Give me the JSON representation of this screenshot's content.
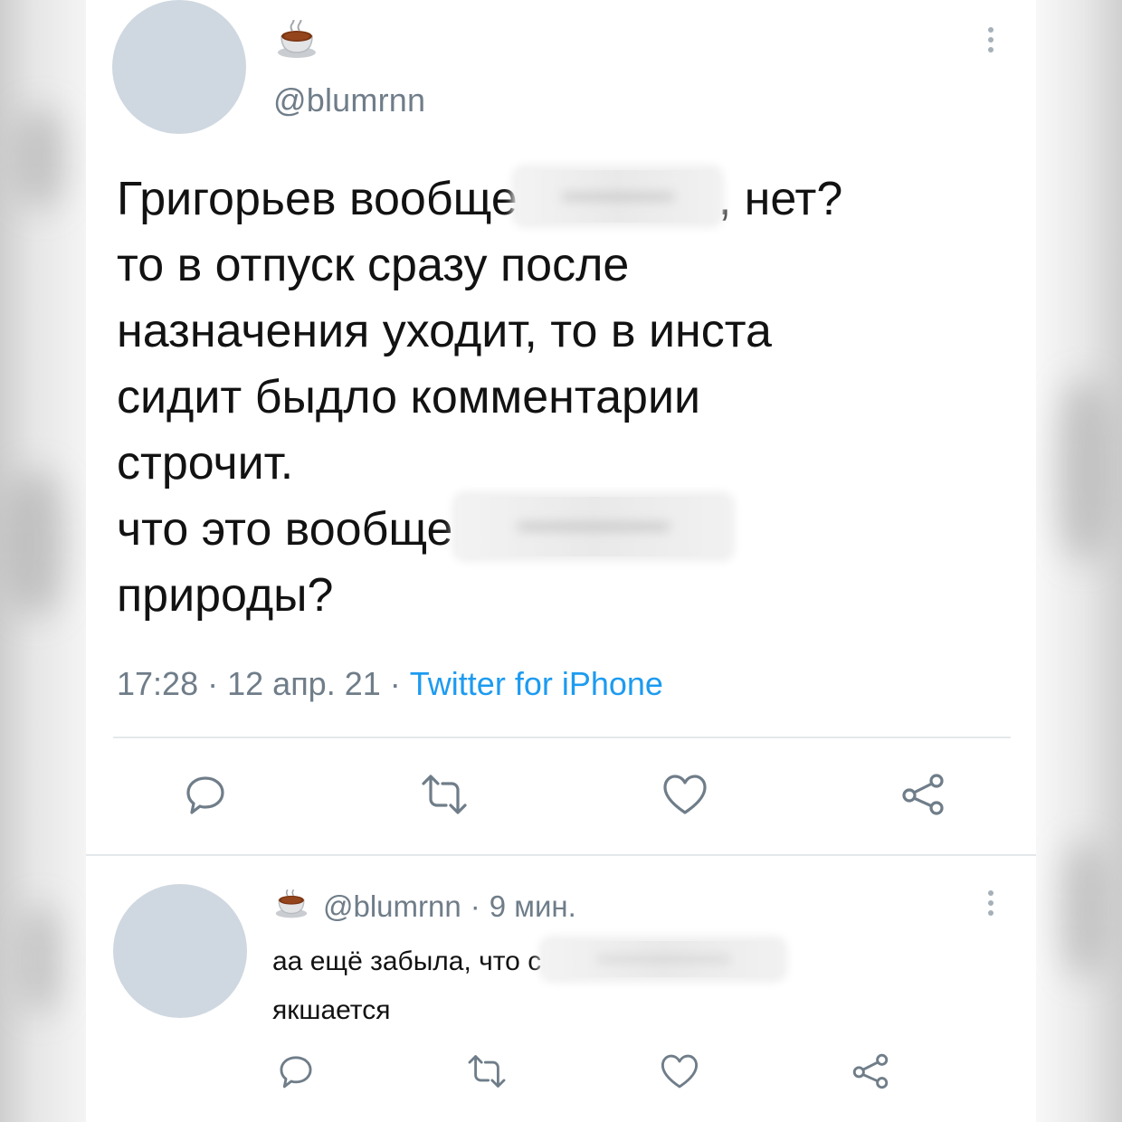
{
  "main_tweet": {
    "handle": "@blumrnn",
    "text_lines": [
      {
        "before": "Григорьев вообще",
        "after": ", нет?"
      },
      {
        "text": "то в отпуск сразу после"
      },
      {
        "text": "назначения уходит, то в инста"
      },
      {
        "text": "сидит быдло комментарии"
      },
      {
        "text": "строчит."
      },
      {
        "before": "что это вообще",
        "after": ""
      },
      {
        "text": "природы?"
      }
    ],
    "time": "17:28",
    "date": "12 апр. 21",
    "separator": "·",
    "source": "Twitter for iPhone",
    "avatar_emoji": "hot-beverage-icon"
  },
  "reply_tweet": {
    "handle": "@blumrnn",
    "separator": "·",
    "age": "9 мин.",
    "text_lines": [
      {
        "before": "аа ещё забыла, что с",
        "after": ""
      },
      {
        "text": "якшается"
      }
    ],
    "avatar_emoji": "hot-beverage-icon"
  },
  "actions": [
    "reply-icon",
    "retweet-icon",
    "like-icon",
    "share-icon"
  ],
  "colors": {
    "text": "#121212",
    "muted": "#6f7d89",
    "link": "#1d9bf0",
    "avatar": "#cfd8e0",
    "icon": "#6f7d89",
    "divider": "#e4e8eb"
  }
}
